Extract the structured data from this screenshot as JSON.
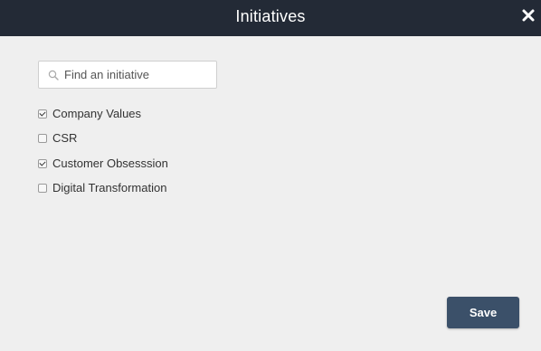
{
  "modal": {
    "title": "Initiatives",
    "close_icon": "close-icon"
  },
  "search": {
    "placeholder": "Find an initiative",
    "value": "",
    "icon": "search-icon"
  },
  "initiatives": [
    {
      "label": "Company Values",
      "checked": true
    },
    {
      "label": "CSR",
      "checked": false
    },
    {
      "label": "Customer Obsesssion",
      "checked": true
    },
    {
      "label": "Digital Transformation",
      "checked": false
    }
  ],
  "footer": {
    "save_label": "Save"
  },
  "colors": {
    "header_bg": "#232a36",
    "body_bg": "#efefef",
    "save_bg": "#3b5069"
  }
}
